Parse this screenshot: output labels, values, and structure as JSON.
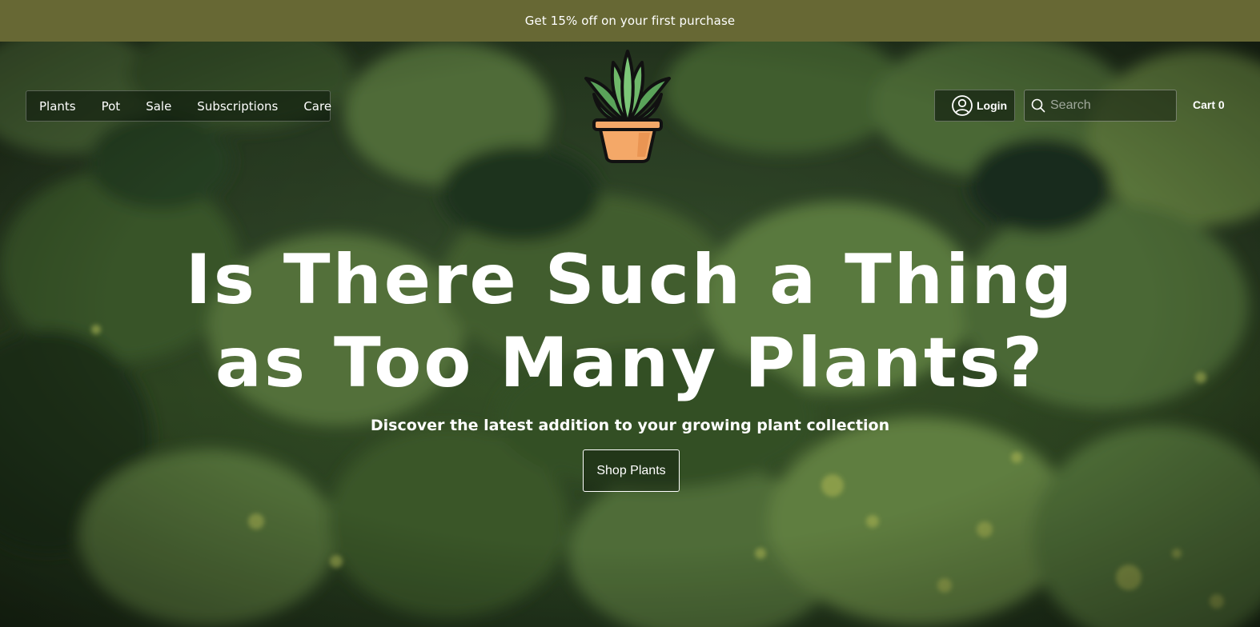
{
  "promo": {
    "text": "Get 15% off on your first purchase"
  },
  "nav": {
    "items": [
      {
        "label": "Plants"
      },
      {
        "label": "Pot"
      },
      {
        "label": "Sale"
      },
      {
        "label": "Subscriptions"
      },
      {
        "label": "Care"
      }
    ]
  },
  "logo": {
    "icon": "potted-plant-icon"
  },
  "account": {
    "login_label": "Login",
    "icon": "user-circle-icon"
  },
  "search": {
    "placeholder": "Search",
    "value": "",
    "icon": "search-icon"
  },
  "cart": {
    "label": "Cart 0"
  },
  "hero": {
    "headline_line1": "Is There Such a Thing",
    "headline_line2": "as Too Many Plants?",
    "subheadline": "Discover the latest addition to your growing plant collection",
    "cta_label": "Shop Plants"
  },
  "colors": {
    "promo_bg": "#676834",
    "leaf_dark": "#2f4a2a",
    "leaf_light": "#6f9a3c",
    "pot": "#f4a868"
  }
}
